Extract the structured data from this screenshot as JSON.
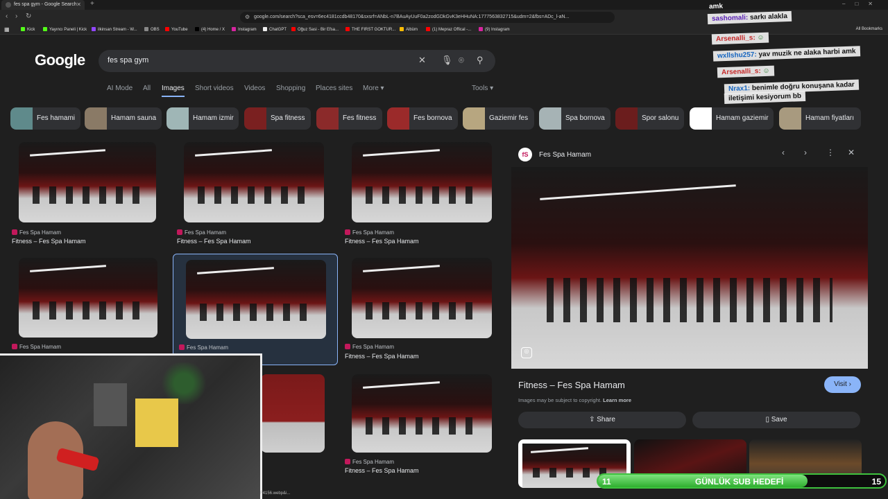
{
  "browser": {
    "tab_title": "fes spa gym - Google Search",
    "url": "google.com/search?sca_esv=6ec4181ccdb48170&sxsrf=ANbL-n7BAuAyUuF0a2zodGDkGvK3eHHuNA:1777563832715&udm=2&fbs=ADc_l-aN...",
    "bookmarks": [
      "Kick",
      "Yayıncı Paneli | Kick",
      "ilkinsan Stream - W...",
      "OBS",
      "YouTube",
      "(4) Home / X",
      "Instagram",
      "ChatGPT",
      "Oğuz Sasi - Bir Efsa...",
      "THE FIRST GOKTUR...",
      "Albüm",
      "(1) Mepraz Offical -...",
      "(9) Instagram"
    ],
    "all_bookmarks": "All Bookmarks"
  },
  "google": {
    "logo": "Google",
    "query": "fes spa gym",
    "tabs": [
      "AI Mode",
      "All",
      "Images",
      "Short videos",
      "Videos",
      "Shopping",
      "Places sites",
      "More ▾"
    ],
    "active_tab": "Images",
    "tools": "Tools ▾"
  },
  "chips": [
    "Fes hamami",
    "Hamam sauna",
    "Hamam izmir",
    "Spa fitness",
    "Fes fitness",
    "Fes bornova",
    "Gaziemir fes",
    "Spa bornova",
    "Spor salonu",
    "Hamam gaziemir",
    "Hamam fiyatları"
  ],
  "results": [
    {
      "source": "Fes Spa Hamam",
      "title": "Fitness – Fes Spa Hamam"
    },
    {
      "source": "Fes Spa Hamam",
      "title": "Fitness – Fes Spa Hamam"
    },
    {
      "source": "Fes Spa Hamam",
      "title": "Fitness – Fes Spa Hamam"
    },
    {
      "source": "Fes Spa Hamam",
      "title": ""
    },
    {
      "source": "Fes Spa Hamam",
      "title": ""
    },
    {
      "source": "Fes Spa Hamam",
      "title": "Fitness – Fes Spa Hamam"
    },
    {
      "source": "",
      "title": ""
    },
    {
      "source": "Fes Spa Hamam",
      "title": "Fitness – Fes Spa Hamam"
    }
  ],
  "panel": {
    "site": "Fes Spa Hamam",
    "title": "Fitness – Fes Spa Hamam",
    "visit": "Visit ›",
    "copyright": "Images may be subject to copyright.",
    "learn_more": "Learn more",
    "share": "Share",
    "save": "Save"
  },
  "stream": {
    "chat": [
      {
        "user": "",
        "msg": "amk"
      },
      {
        "user": "sashomali:",
        "msg": "sarkı alakla"
      },
      {
        "user": "Arsenalli_s:",
        "msg": "☺"
      },
      {
        "user": "wxllshu257:",
        "msg": "yav muzik ne alaka harbi amk"
      },
      {
        "user": "Arsenalli_s:",
        "msg": "☺"
      },
      {
        "user": "Nrax1:",
        "msg": "benimle doğru konuşana kadar"
      },
      {
        "user": "",
        "msg": "iletişimi kesiyorum bb"
      }
    ],
    "sub_goal": {
      "label": "GÜNLÜK SUB HEDEFİ",
      "current": "11",
      "target": "15",
      "fraction": 0.73
    },
    "file_tag": "F4156.webp&i..."
  }
}
